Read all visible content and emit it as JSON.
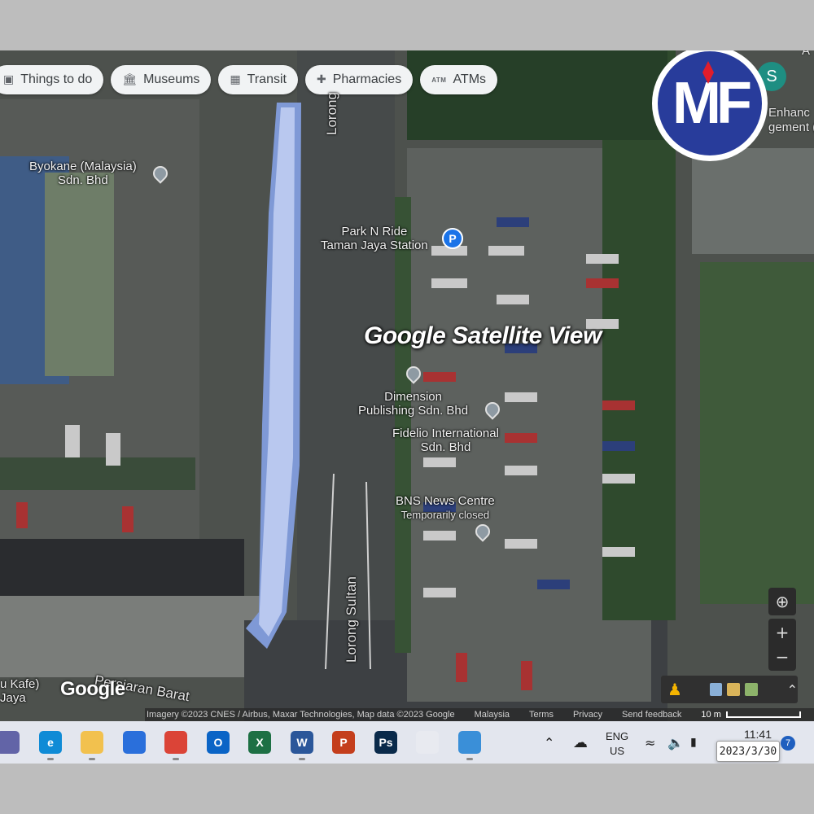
{
  "chips": [
    {
      "label": "Things to do",
      "icon": "camera-icon"
    },
    {
      "label": "Museums",
      "icon": "museum-icon"
    },
    {
      "label": "Transit",
      "icon": "transit-icon"
    },
    {
      "label": "Pharmacies",
      "icon": "pharmacy-icon"
    },
    {
      "label": "ATMs",
      "icon": "atm-icon",
      "icon_text": "ATM"
    }
  ],
  "pois": {
    "byokane": {
      "line1": "Byokane (Malaysia)",
      "line2": "Sdn. Bhd"
    },
    "parkride": {
      "line1": "Park N Ride",
      "line2": "Taman Jaya Station",
      "pin": "P"
    },
    "dimension": {
      "line1": "Dimension",
      "line2": "Publishing Sdn. Bhd"
    },
    "fidelio": {
      "line1": "Fidelio International",
      "line2": "Sdn. Bhd"
    },
    "bns": {
      "line1": "BNS News Centre",
      "line2": "Temporarily closed"
    },
    "kafe": {
      "line1": "u Kafe)",
      "line2": "Jaya"
    }
  },
  "roads": {
    "lorong_top": "Lorong",
    "lorong_sultan": "Lorong Sultan",
    "persiaran": "Persiaran Barat"
  },
  "overlay": {
    "headline": "Google Satellite View",
    "logo_text": "MF",
    "avatar_letter": "S",
    "right_text_1": "Enhanc",
    "right_text_2": "gement (",
    "right_text_0": "A"
  },
  "map_footer": {
    "watermark": "Google",
    "imagery": "Imagery ©2023 CNES / Airbus, Maxar Technologies, Map data ©2023 Google",
    "country": "Malaysia",
    "terms": "Terms",
    "privacy": "Privacy",
    "feedback": "Send feedback",
    "scale": "10 m"
  },
  "taskbar": {
    "apps": [
      {
        "name": "meet-app",
        "letter": "",
        "color": "#6264a7"
      },
      {
        "name": "edge-app",
        "letter": "e",
        "color": "#0f8bd6"
      },
      {
        "name": "file-explorer-app",
        "letter": "",
        "color": "#f2c14e"
      },
      {
        "name": "store-app",
        "letter": "",
        "color": "#2a6fdb"
      },
      {
        "name": "chrome-app",
        "letter": "",
        "color": "#db4437"
      },
      {
        "name": "outlook-app",
        "letter": "O",
        "color": "#0a64c6"
      },
      {
        "name": "excel-app",
        "letter": "X",
        "color": "#1d7044"
      },
      {
        "name": "word-app",
        "letter": "W",
        "color": "#2b579a"
      },
      {
        "name": "powerpoint-app",
        "letter": "P",
        "color": "#c43e1c"
      },
      {
        "name": "photoshop-app",
        "letter": "Ps",
        "color": "#0a2a4a"
      },
      {
        "name": "snipping-app",
        "letter": "",
        "color": "#e8eaf0"
      },
      {
        "name": "globe-app",
        "letter": "",
        "color": "#3a8fd8"
      }
    ],
    "lang_1": "ENG",
    "lang_2": "US",
    "time": "11:41",
    "date": "2023/3/30",
    "notifications": "7"
  }
}
